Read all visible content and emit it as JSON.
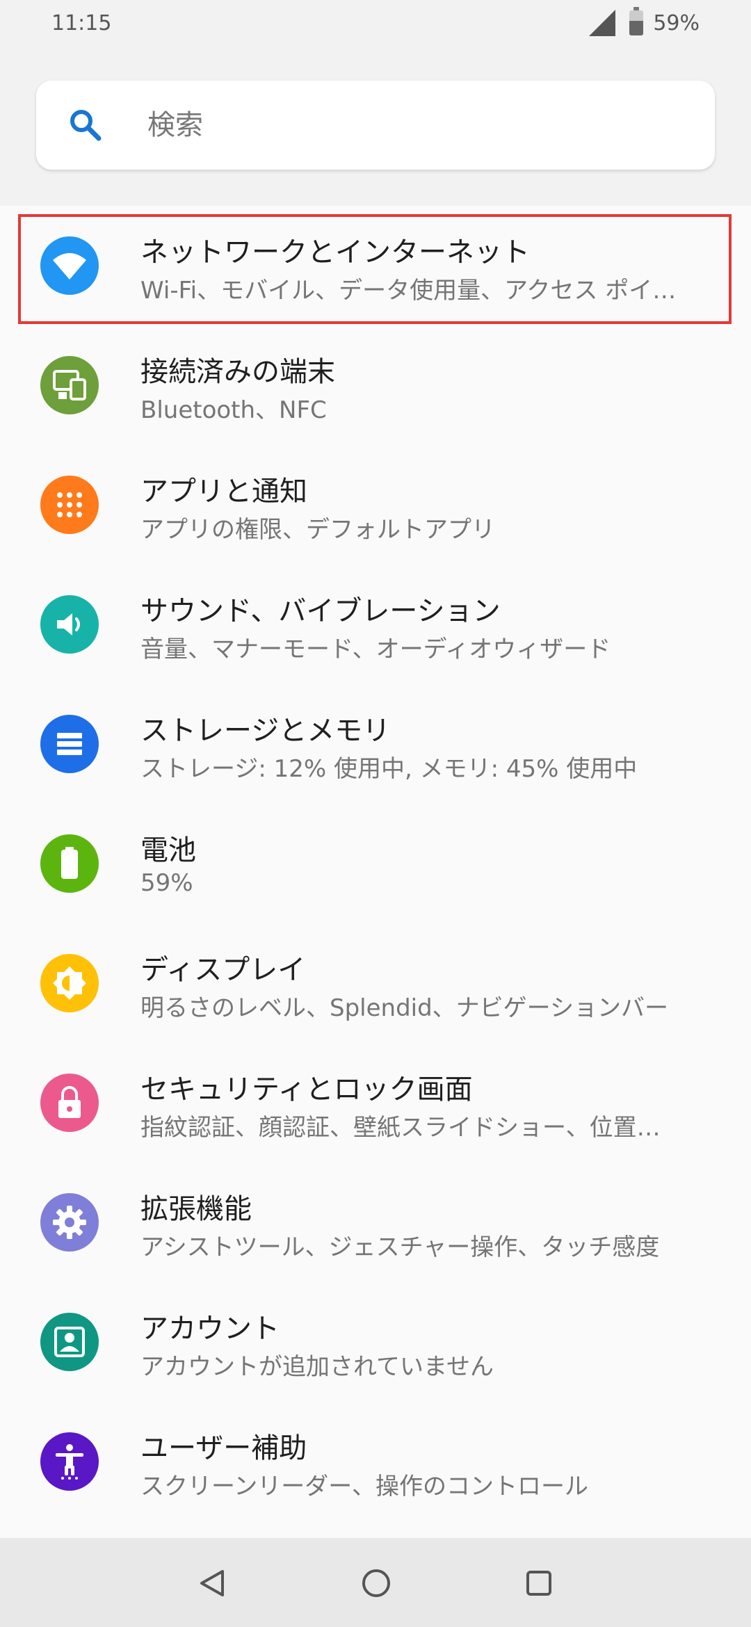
{
  "status_bar": {
    "time": "11:15",
    "battery_percent": "59%",
    "battery_level": 0.59
  },
  "search": {
    "placeholder": "検索"
  },
  "settings": [
    {
      "title": "ネットワークとインターネット",
      "subtitle": "Wi-Fi、モバイル、データ使用量、アクセス ポイ…",
      "icon": "wifi-icon",
      "color": "#2196f3",
      "highlighted": true
    },
    {
      "title": "接続済みの端末",
      "subtitle": "Bluetooth、NFC",
      "icon": "devices-icon",
      "color": "#6d9f3b"
    },
    {
      "title": "アプリと通知",
      "subtitle": "アプリの権限、デフォルトアプリ",
      "icon": "apps-grid-icon",
      "color": "#ff7a1a"
    },
    {
      "title": "サウンド、バイブレーション",
      "subtitle": "音量、マナーモード、オーディオウィザード",
      "icon": "volume-icon",
      "color": "#17b3a8"
    },
    {
      "title": "ストレージとメモリ",
      "subtitle": "ストレージ: 12% 使用中, メモリ: 45% 使用中",
      "icon": "storage-icon",
      "color": "#1e6ee8"
    },
    {
      "title": "電池",
      "subtitle": "59%",
      "icon": "battery-icon",
      "color": "#5cb50f"
    },
    {
      "title": "ディスプレイ",
      "subtitle": "明るさのレベル、Splendid、ナビゲーションバー",
      "icon": "brightness-icon",
      "color": "#ffc107"
    },
    {
      "title": "セキュリティとロック画面",
      "subtitle": "指紋認証、顔認証、壁紙スライドショー、位置…",
      "icon": "lock-icon",
      "color": "#ec5a8d"
    },
    {
      "title": "拡張機能",
      "subtitle": "アシストツール、ジェスチャー操作、タッチ感度",
      "icon": "gear-icon",
      "color": "#7f7fd9"
    },
    {
      "title": "アカウント",
      "subtitle": "アカウントが追加されていません",
      "icon": "account-icon",
      "color": "#0f9784"
    },
    {
      "title": "ユーザー補助",
      "subtitle": "スクリーンリーダー、操作のコントロール",
      "icon": "accessibility-icon",
      "color": "#5a17c6"
    }
  ],
  "nav_bar": {
    "back_icon": "back-triangle-icon",
    "home_icon": "home-circle-icon",
    "recents_icon": "recents-square-icon"
  }
}
